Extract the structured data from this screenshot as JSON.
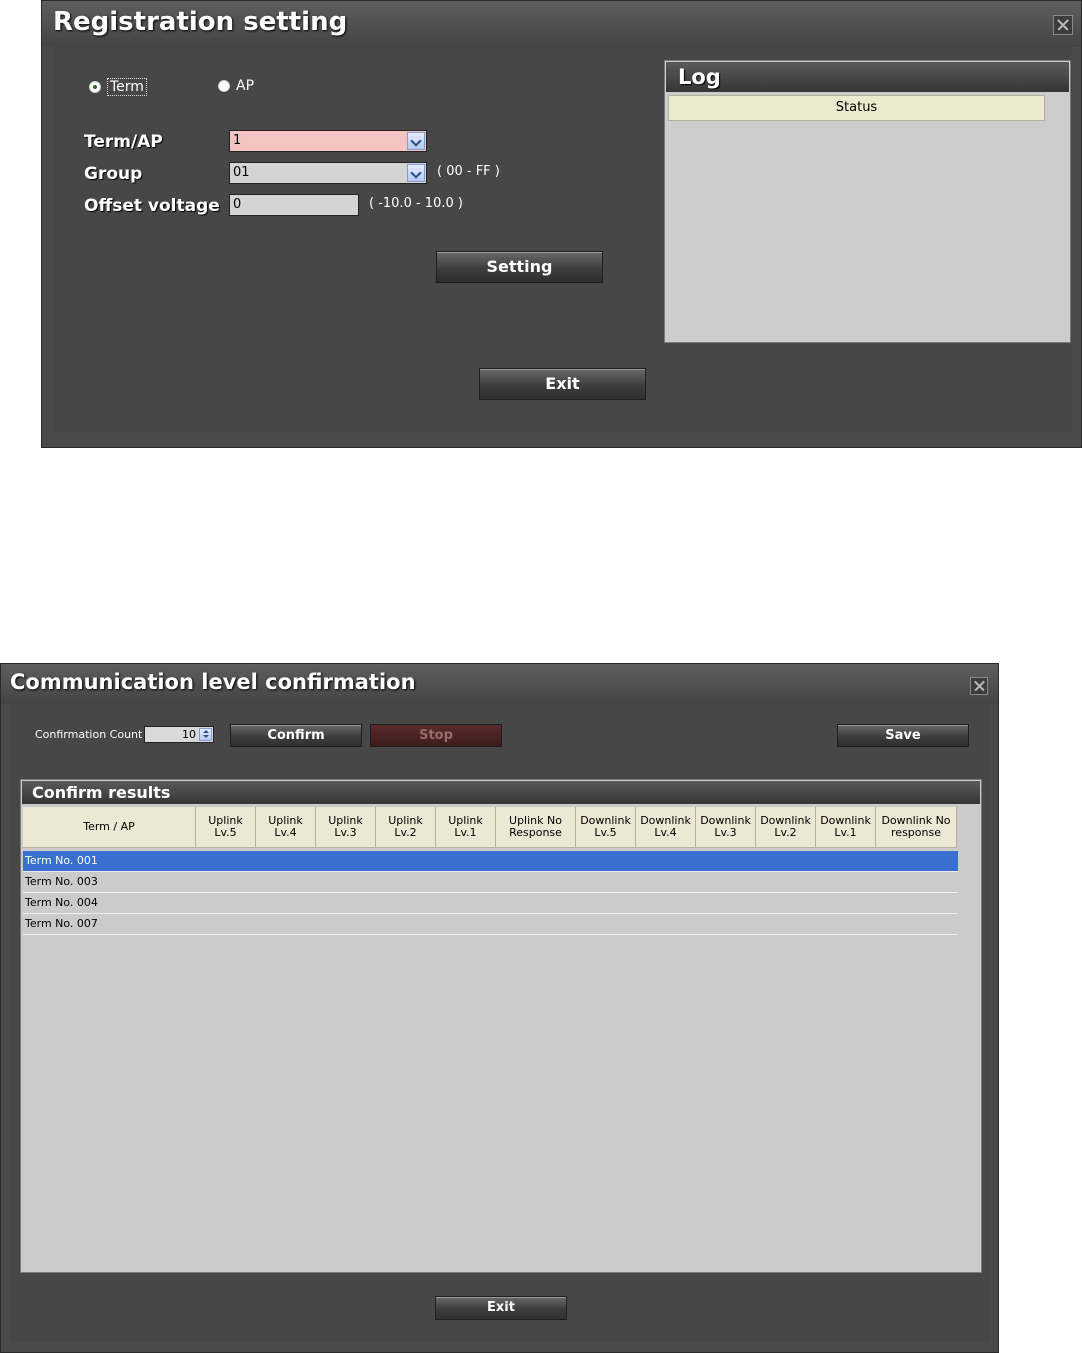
{
  "registration": {
    "title": "Registration setting",
    "radio_term": "Term",
    "radio_ap": "AP",
    "term_ap_label": "Term/AP",
    "term_ap_value": "1",
    "group_label": "Group",
    "group_value": "01",
    "group_range": "( 00 - FF )",
    "offset_label": "Offset voltage",
    "offset_value": "0",
    "offset_range": "( -10.0 - 10.0 )",
    "setting_button": "Setting",
    "log_title": "Log",
    "log_column": "Status",
    "exit_button": "Exit"
  },
  "communication": {
    "title": "Communication level confirmation",
    "count_label": "Confirmation Count",
    "count_value": "10",
    "confirm_button": "Confirm",
    "stop_button": "Stop",
    "save_button": "Save",
    "results_title": "Confirm results",
    "columns": [
      "Term / AP",
      "Uplink Lv.5",
      "Uplink Lv.4",
      "Uplink Lv.3",
      "Uplink Lv.2",
      "Uplink Lv.1",
      "Uplink No Response",
      "Downlink Lv.5",
      "Downlink Lv.4",
      "Downlink Lv.3",
      "Downlink Lv.2",
      "Downlink Lv.1",
      "Downlink No response"
    ],
    "rows": [
      "Term No. 001",
      "Term No. 003",
      "Term No. 004",
      "Term No. 007"
    ],
    "exit_button": "Exit"
  },
  "colors": {
    "selected_row": "#3a6fd0",
    "term_field_bg": "#f6c3c3",
    "stop_button_bg": "#4a2020"
  }
}
